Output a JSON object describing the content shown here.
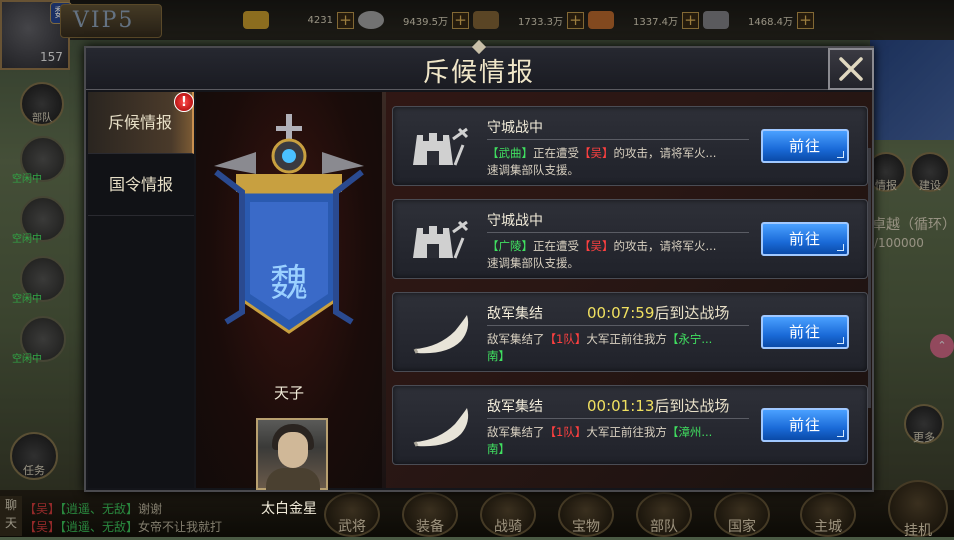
{
  "hud": {
    "kingdom_badge": "魏",
    "level": "157",
    "vip": "VIP5",
    "resources": [
      {
        "name": "gold-icon",
        "value": "4231",
        "color": "#d8a830"
      },
      {
        "name": "silver-icon",
        "value": "9439.5万",
        "color": "#b0b0b0"
      },
      {
        "name": "wood-icon",
        "value": "1733.3万",
        "color": "#8a6a3a"
      },
      {
        "name": "food-icon",
        "value": "1337.4万",
        "color": "#c87030"
      },
      {
        "name": "iron-icon",
        "value": "1468.4万",
        "color": "#8a8a90"
      }
    ],
    "left_buttons": {
      "army": "部队",
      "task": "任务"
    },
    "hero_status": [
      "空闲中",
      "空闲中",
      "空闲中",
      "空闲中"
    ],
    "right": {
      "intel": "情报",
      "build": "建设",
      "event_title": "卓越（循环）",
      "event_value": "/100000",
      "more": "更多"
    },
    "chat": {
      "label": "聊天",
      "lines": [
        {
          "kingdom": "【吴】",
          "tag": "【逍遥、无敌】",
          "msg": "谢谢"
        },
        {
          "kingdom": "【吴】",
          "tag": "【逍遥、无敌】",
          "msg": "女帝不让我就打"
        }
      ]
    },
    "nav": [
      "武将",
      "装备",
      "战骑",
      "宝物",
      "部队",
      "国家",
      "主城",
      "挂机"
    ]
  },
  "dialog": {
    "title": "斥候情报",
    "tabs": [
      {
        "label": "斥候情报",
        "active": true,
        "badge": "!"
      },
      {
        "label": "国令情报",
        "active": false
      }
    ],
    "emblem_char": "魏",
    "emblem_title": "天子",
    "person_name": "太白金星",
    "reports": [
      {
        "icon": "castle-icon",
        "title": "守城战中",
        "timer": "",
        "timer_suffix": "",
        "desc_pre": "",
        "place": "【武曲】",
        "mid": "正在遭受",
        "enemy": "【吴】",
        "tail": "的攻击，请将军火...",
        "line2": "速调集部队支援。",
        "button": "前往"
      },
      {
        "icon": "castle-icon",
        "title": "守城战中",
        "timer": "",
        "timer_suffix": "",
        "desc_pre": "",
        "place": "【广陵】",
        "mid": "正在遭受",
        "enemy": "【吴】",
        "tail": "的攻击，请将军火...",
        "line2": "速调集部队支援。",
        "button": "前往"
      },
      {
        "icon": "horn-icon",
        "title": "敌军集结",
        "timer": "00:07:59",
        "timer_suffix": "后到达战场",
        "desc_pre": "敌军集结了",
        "troop": "【1队】",
        "desc_mid": "大军正前往我方",
        "dest": "【永宁...",
        "dest2": "南】",
        "button": "前往"
      },
      {
        "icon": "horn-icon",
        "title": "敌军集结",
        "timer": "00:01:13",
        "timer_suffix": "后到达战场",
        "desc_pre": "敌军集结了",
        "troop": "【1队】",
        "desc_mid": "大军正前往我方",
        "dest": "【漳州...",
        "dest2": "南】",
        "button": "前往"
      }
    ]
  }
}
